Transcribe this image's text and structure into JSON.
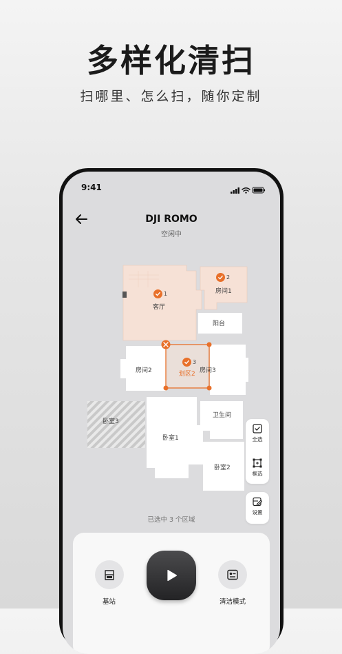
{
  "promo": {
    "title": "多样化清扫",
    "subtitle": "扫哪里、怎么扫，随你定制"
  },
  "status_bar": {
    "time": "9:41"
  },
  "header": {
    "title": "DJI ROMO",
    "status": "空闲中"
  },
  "map": {
    "rooms": {
      "living": "客厅",
      "room1": "房间1",
      "balcony": "阳台",
      "room2": "房间2",
      "room3": "房间3",
      "zone2": "划区2",
      "bedroom3": "卧室3",
      "bathroom": "卫生间",
      "bedroom1": "卧室1",
      "bedroom2": "卧室2"
    },
    "badges": {
      "living": "1",
      "room1": "2",
      "zone2": "3"
    }
  },
  "side_panel": {
    "select_all": "全选",
    "box_select": "框选",
    "settings": "设置"
  },
  "selection_info": "已选中 3 个区域",
  "bottom": {
    "dock_label": "基站",
    "mode_label": "清洁模式"
  },
  "colors": {
    "accent": "#e8702a",
    "selected_room": "#f6e1d6",
    "room": "#ffffff",
    "background": "#dcdcde"
  }
}
